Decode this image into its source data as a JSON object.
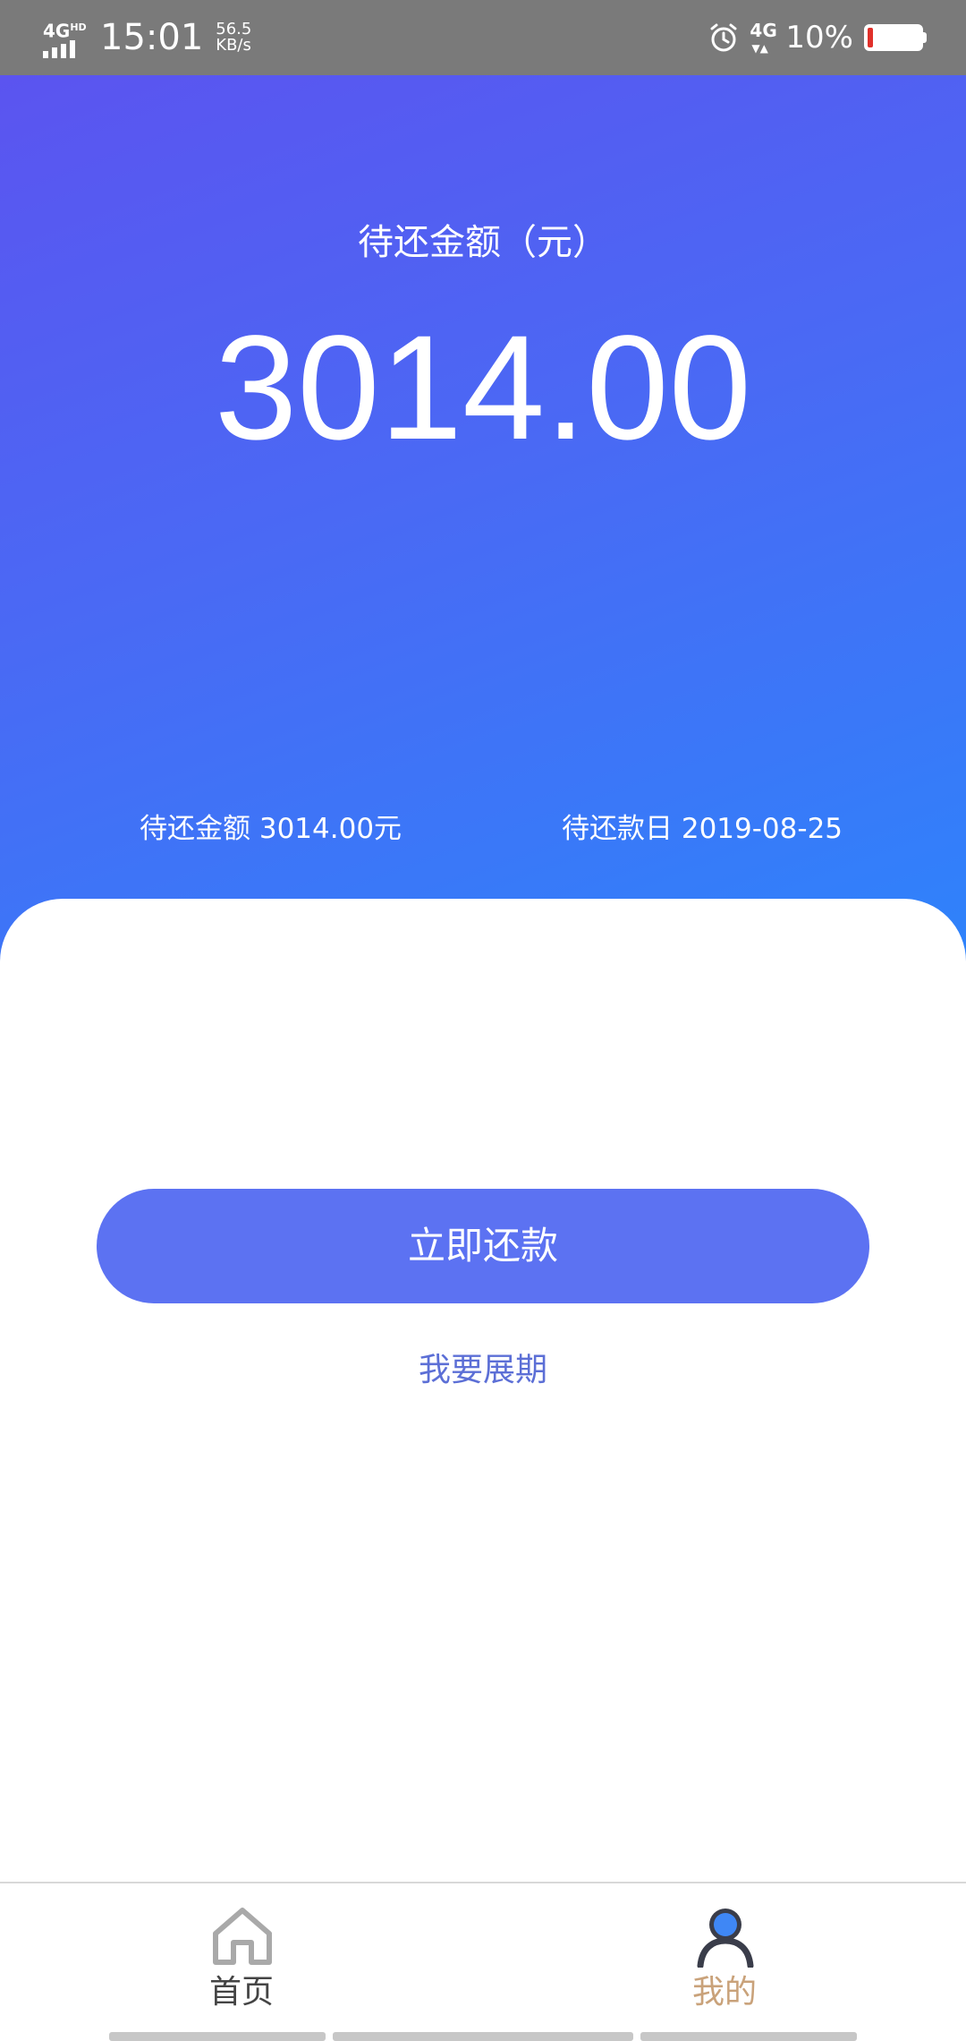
{
  "status_bar": {
    "network": "4G",
    "network_sup": "HD",
    "time": "15:01",
    "speed_value": "56.5",
    "speed_unit": "KB/s",
    "data_network": "4G",
    "battery": "10%",
    "icons": [
      "signal-icon",
      "alarm-icon",
      "battery-icon"
    ],
    "battery_level": 0.1,
    "battery_fill_color": "#e0302a"
  },
  "header": {
    "title": "待还金额（元）",
    "amount": "3014.00",
    "due_amount": "待还金额 3014.00元",
    "due_date": "待还款日 2019-08-25",
    "gradient_colors": [
      "#5b54f0",
      "#4a69f4",
      "#2e83fb"
    ]
  },
  "actions": {
    "repay_label": "立即还款",
    "extend_label": "我要展期",
    "button_color": "#5c72f2",
    "link_color": "#5c6fd6"
  },
  "tab_bar": {
    "tabs": [
      {
        "label": "首页",
        "icon": "home-icon",
        "active": false
      },
      {
        "label": "我的",
        "icon": "user-icon",
        "active": true
      }
    ],
    "active_color": "#c9a27a"
  }
}
